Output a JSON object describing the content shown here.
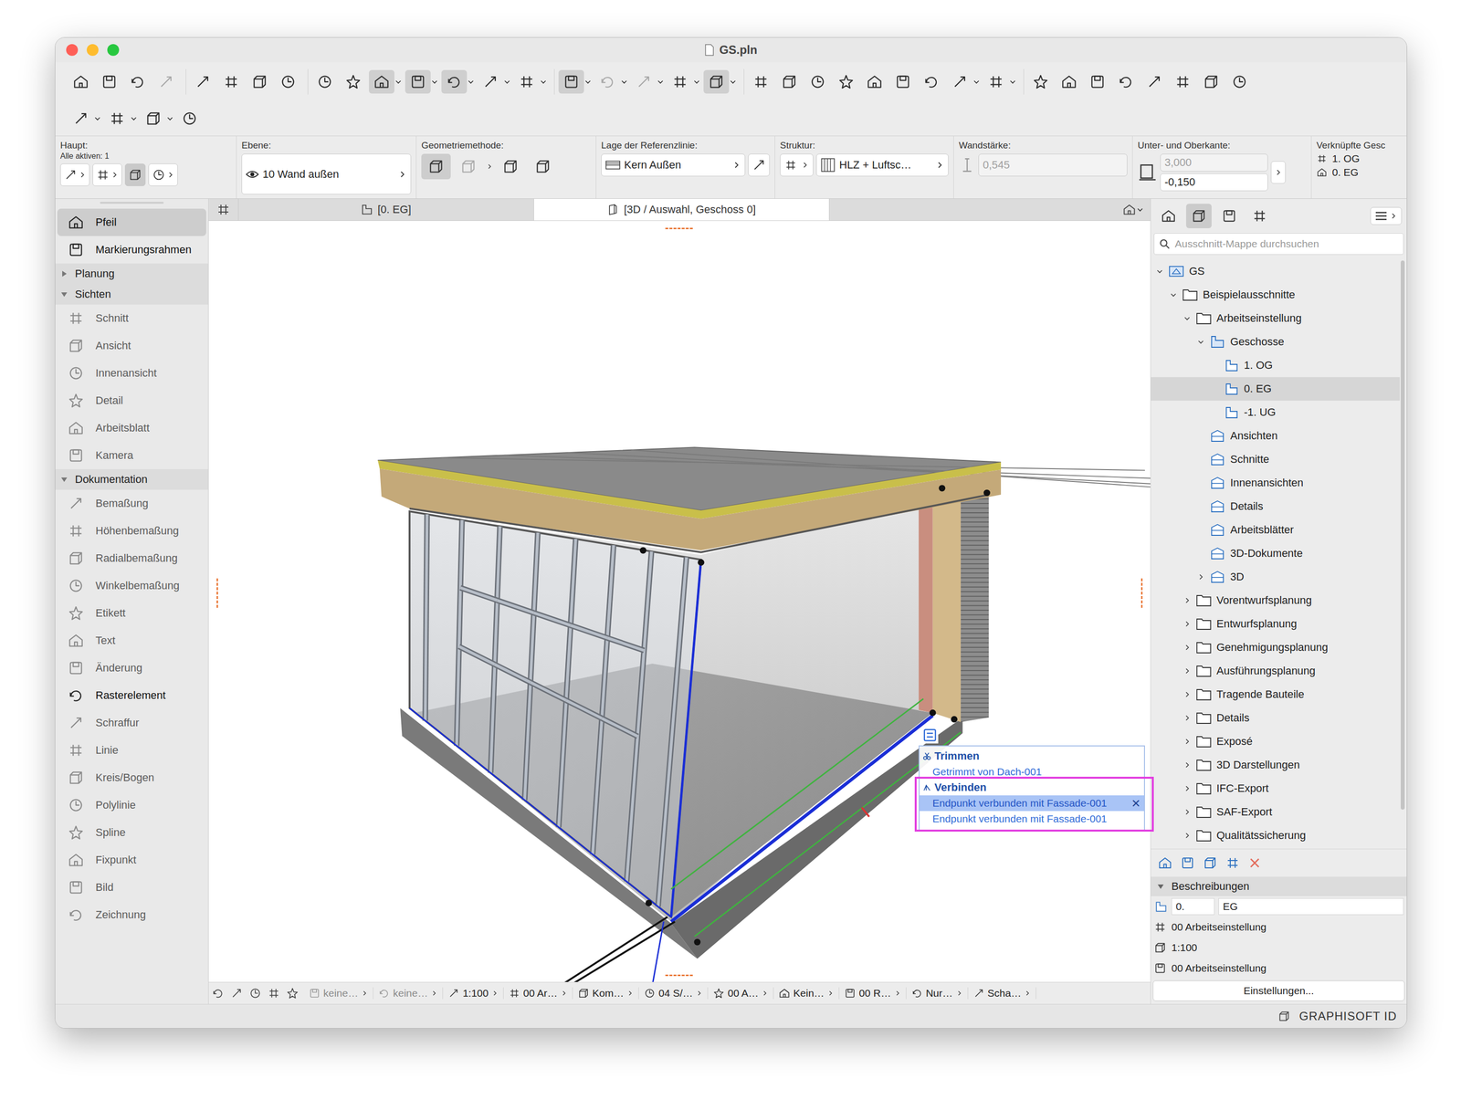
{
  "window": {
    "title": "GS.pln"
  },
  "toolbar_main": [
    [
      {
        "menu": false,
        "pressed": false,
        "disabled": false
      },
      {
        "menu": false,
        "pressed": false,
        "disabled": false
      },
      {
        "menu": false,
        "pressed": false,
        "disabled": false
      },
      {
        "menu": false,
        "pressed": false,
        "disabled": true
      }
    ],
    [
      {
        "menu": false,
        "pressed": false,
        "disabled": false
      },
      {
        "menu": false,
        "pressed": false,
        "disabled": false
      },
      {
        "menu": false,
        "pressed": false,
        "disabled": false
      },
      {
        "menu": false,
        "pressed": false,
        "disabled": false
      }
    ],
    [
      {
        "menu": false,
        "pressed": false,
        "disabled": false
      },
      {
        "menu": false,
        "pressed": false,
        "disabled": false
      },
      {
        "menu": true,
        "pressed": true,
        "disabled": false
      },
      {
        "menu": true,
        "pressed": true,
        "disabled": false
      },
      {
        "menu": true,
        "pressed": true,
        "disabled": false
      },
      {
        "menu": true,
        "pressed": false,
        "disabled": false
      },
      {
        "menu": true,
        "pressed": false,
        "disabled": false
      }
    ],
    [
      {
        "menu": true,
        "pressed": true,
        "disabled": false
      },
      {
        "menu": true,
        "pressed": false,
        "disabled": true
      },
      {
        "menu": true,
        "pressed": false,
        "disabled": true
      },
      {
        "menu": true,
        "pressed": false,
        "disabled": false
      },
      {
        "menu": true,
        "pressed": true,
        "disabled": false
      }
    ],
    [
      {
        "menu": false,
        "pressed": false,
        "disabled": false
      },
      {
        "menu": false,
        "pressed": false,
        "disabled": false
      },
      {
        "menu": false,
        "pressed": false,
        "disabled": false
      },
      {
        "menu": false,
        "pressed": false,
        "disabled": false
      },
      {
        "menu": false,
        "pressed": false,
        "disabled": false
      },
      {
        "menu": false,
        "pressed": false,
        "disabled": false
      },
      {
        "menu": false,
        "pressed": false,
        "disabled": false
      },
      {
        "menu": true,
        "pressed": false,
        "disabled": false
      },
      {
        "menu": true,
        "pressed": false,
        "disabled": false
      }
    ],
    [
      {
        "menu": false,
        "pressed": false,
        "disabled": false
      },
      {
        "menu": false,
        "pressed": false,
        "disabled": false
      },
      {
        "menu": false,
        "pressed": false,
        "disabled": false
      },
      {
        "menu": false,
        "pressed": false,
        "disabled": false
      },
      {
        "menu": false,
        "pressed": false,
        "disabled": false
      },
      {
        "menu": false,
        "pressed": false,
        "disabled": false
      },
      {
        "menu": false,
        "pressed": false,
        "disabled": false
      },
      {
        "menu": false,
        "pressed": false,
        "disabled": false
      }
    ]
  ],
  "toolbar_secondary": [
    {
      "menu": true,
      "pressed": false,
      "disabled": false
    },
    {
      "menu": true,
      "pressed": false,
      "disabled": false
    },
    {
      "menu": true,
      "pressed": false,
      "disabled": false
    },
    {
      "menu": false,
      "pressed": false,
      "disabled": false
    }
  ],
  "info_box": {
    "main": {
      "label": "Haupt:",
      "active": "Alle aktiven: 1",
      "controls": [
        {
          "pressed": false
        },
        {
          "pressed": false
        },
        {
          "pressed": true
        },
        {
          "pressed": false
        }
      ]
    },
    "layer": {
      "label": "Ebene:",
      "value": "10 Wand außen"
    },
    "geometry": {
      "label": "Geometriemethode:",
      "options": [
        {
          "selected": true,
          "disabled": false
        },
        {
          "selected": false,
          "disabled": true
        },
        {
          "selected": false,
          "disabled": false
        },
        {
          "selected": false,
          "disabled": false
        }
      ]
    },
    "reference_line": {
      "label": "Lage der Referenzlinie:",
      "value": "Kern Außen"
    },
    "structure": {
      "label": "Struktur:",
      "value": "HLZ + Luftsc…"
    },
    "thickness": {
      "label": "Wandstärke:",
      "value": "0,545",
      "disabled": true
    },
    "top_bottom": {
      "label": "Unter- und Oberkante:",
      "top": "3,000",
      "top_disabled": true,
      "bottom": "-0,150"
    },
    "linked_stories": {
      "label": "Verknüpfte Gesc",
      "top": "1. OG",
      "bottom": "0. EG"
    }
  },
  "toolbox": [
    {
      "kind": "tool",
      "label": "Pfeil",
      "selected": true,
      "disabled": false
    },
    {
      "kind": "tool",
      "label": "Markierungsrahmen",
      "selected": false,
      "disabled": false
    },
    {
      "kind": "section",
      "label": "Planung",
      "expanded": false
    },
    {
      "kind": "section",
      "label": "Sichten",
      "expanded": true
    },
    {
      "kind": "tool",
      "label": "Schnitt",
      "selected": false,
      "disabled": true
    },
    {
      "kind": "tool",
      "label": "Ansicht",
      "selected": false,
      "disabled": true
    },
    {
      "kind": "tool",
      "label": "Innenansicht",
      "selected": false,
      "disabled": true
    },
    {
      "kind": "tool",
      "label": "Detail",
      "selected": false,
      "disabled": true
    },
    {
      "kind": "tool",
      "label": "Arbeitsblatt",
      "selected": false,
      "disabled": true
    },
    {
      "kind": "tool",
      "label": "Kamera",
      "selected": false,
      "disabled": true
    },
    {
      "kind": "section",
      "label": "Dokumentation",
      "expanded": true
    },
    {
      "kind": "tool",
      "label": "Bemaßung",
      "selected": false,
      "disabled": true
    },
    {
      "kind": "tool",
      "label": "Höhenbemaßung",
      "selected": false,
      "disabled": true
    },
    {
      "kind": "tool",
      "label": "Radialbemaßung",
      "selected": false,
      "disabled": true
    },
    {
      "kind": "tool",
      "label": "Winkelbemaßung",
      "selected": false,
      "disabled": true
    },
    {
      "kind": "tool",
      "label": "Etikett",
      "selected": false,
      "disabled": true
    },
    {
      "kind": "tool",
      "label": "Text",
      "selected": false,
      "disabled": true
    },
    {
      "kind": "tool",
      "label": "Änderung",
      "selected": false,
      "disabled": true
    },
    {
      "kind": "tool",
      "label": "Rasterelement",
      "selected": false,
      "disabled": false
    },
    {
      "kind": "tool",
      "label": "Schraffur",
      "selected": false,
      "disabled": true
    },
    {
      "kind": "tool",
      "label": "Linie",
      "selected": false,
      "disabled": true
    },
    {
      "kind": "tool",
      "label": "Kreis/Bogen",
      "selected": false,
      "disabled": true
    },
    {
      "kind": "tool",
      "label": "Polylinie",
      "selected": false,
      "disabled": true
    },
    {
      "kind": "tool",
      "label": "Spline",
      "selected": false,
      "disabled": true
    },
    {
      "kind": "tool",
      "label": "Fixpunkt",
      "selected": false,
      "disabled": true
    },
    {
      "kind": "tool",
      "label": "Bild",
      "selected": false,
      "disabled": true
    },
    {
      "kind": "tool",
      "label": "Zeichnung",
      "selected": false,
      "disabled": true
    }
  ],
  "tabs": [
    {
      "label": "[0. EG]",
      "selected": false,
      "kind": "plan"
    },
    {
      "label": "[3D / Auswahl, Geschoss 0]",
      "selected": true,
      "kind": "3d"
    }
  ],
  "popup": {
    "close": "×",
    "sections": [
      {
        "title": "Trimmen",
        "highlighted": false,
        "items": [
          {
            "label": "Getrimmt von Dach-001",
            "selected": false
          }
        ]
      },
      {
        "title": "Verbinden",
        "highlighted": true,
        "items": [
          {
            "label": "Endpunkt verbunden mit Fassade-001",
            "selected": true
          },
          {
            "label": "Endpunkt verbunden mit Fassade-001",
            "selected": false
          }
        ]
      }
    ]
  },
  "status_bar": [
    {
      "label": "keine…",
      "disabled": true
    },
    {
      "label": "keine…",
      "disabled": true
    },
    {
      "label": "1:100",
      "disabled": false
    },
    {
      "label": "00 Ar…",
      "disabled": false
    },
    {
      "label": "Kom…",
      "disabled": false
    },
    {
      "label": "04 S/…",
      "disabled": false
    },
    {
      "label": "00 A…",
      "disabled": false
    },
    {
      "label": "Kein…",
      "disabled": false
    },
    {
      "label": "00 R…",
      "disabled": false
    },
    {
      "label": "Nur…",
      "disabled": false
    },
    {
      "label": "Scha…",
      "disabled": false
    }
  ],
  "navigator": {
    "modes": [
      {
        "selected": false
      },
      {
        "selected": true
      },
      {
        "selected": false
      },
      {
        "selected": false
      }
    ],
    "search": {
      "placeholder": "Ausschnitt-Mappe durchsuchen"
    },
    "tree": [
      {
        "label": "GS",
        "level": 0,
        "expandable": true,
        "expanded": true,
        "selected": false,
        "kind": "project"
      },
      {
        "label": "Beispielausschnitte",
        "level": 1,
        "expandable": true,
        "expanded": true,
        "selected": false,
        "kind": "folder"
      },
      {
        "label": "Arbeitseinstellung",
        "level": 2,
        "expandable": true,
        "expanded": true,
        "selected": false,
        "kind": "folder"
      },
      {
        "label": "Geschosse",
        "level": 3,
        "expandable": true,
        "expanded": true,
        "selected": false,
        "kind": "stories"
      },
      {
        "label": "1. OG",
        "level": 4,
        "expandable": false,
        "expanded": false,
        "selected": false,
        "kind": "story"
      },
      {
        "label": "0. EG",
        "level": 4,
        "expandable": false,
        "expanded": false,
        "selected": true,
        "kind": "story"
      },
      {
        "label": "-1. UG",
        "level": 4,
        "expandable": false,
        "expanded": false,
        "selected": false,
        "kind": "story"
      },
      {
        "label": "Ansichten",
        "level": 3,
        "expandable": false,
        "expanded": false,
        "selected": false,
        "kind": "view"
      },
      {
        "label": "Schnitte",
        "level": 3,
        "expandable": false,
        "expanded": false,
        "selected": false,
        "kind": "view"
      },
      {
        "label": "Innenansichten",
        "level": 3,
        "expandable": false,
        "expanded": false,
        "selected": false,
        "kind": "view"
      },
      {
        "label": "Details",
        "level": 3,
        "expandable": false,
        "expanded": false,
        "selected": false,
        "kind": "view"
      },
      {
        "label": "Arbeitsblätter",
        "level": 3,
        "expandable": false,
        "expanded": false,
        "selected": false,
        "kind": "view"
      },
      {
        "label": "3D-Dokumente",
        "level": 3,
        "expandable": false,
        "expanded": false,
        "selected": false,
        "kind": "view"
      },
      {
        "label": "3D",
        "level": 3,
        "expandable": true,
        "expanded": false,
        "selected": false,
        "kind": "view"
      },
      {
        "label": "Vorentwurfsplanung",
        "level": 2,
        "expandable": true,
        "expanded": false,
        "selected": false,
        "kind": "folder"
      },
      {
        "label": "Entwurfsplanung",
        "level": 2,
        "expandable": true,
        "expanded": false,
        "selected": false,
        "kind": "folder"
      },
      {
        "label": "Genehmigungsplanung",
        "level": 2,
        "expandable": true,
        "expanded": false,
        "selected": false,
        "kind": "folder"
      },
      {
        "label": "Ausführungsplanung",
        "level": 2,
        "expandable": true,
        "expanded": false,
        "selected": false,
        "kind": "folder"
      },
      {
        "label": "Tragende Bauteile",
        "level": 2,
        "expandable": true,
        "expanded": false,
        "selected": false,
        "kind": "folder"
      },
      {
        "label": "Details",
        "level": 2,
        "expandable": true,
        "expanded": false,
        "selected": false,
        "kind": "folder"
      },
      {
        "label": "Exposé",
        "level": 2,
        "expandable": true,
        "expanded": false,
        "selected": false,
        "kind": "folder"
      },
      {
        "label": "3D Darstellungen",
        "level": 2,
        "expandable": true,
        "expanded": false,
        "selected": false,
        "kind": "folder"
      },
      {
        "label": "IFC-Export",
        "level": 2,
        "expandable": true,
        "expanded": false,
        "selected": false,
        "kind": "folder"
      },
      {
        "label": "SAF-Export",
        "level": 2,
        "expandable": true,
        "expanded": false,
        "selected": false,
        "kind": "folder"
      },
      {
        "label": "Qualitätssicherung",
        "level": 2,
        "expandable": true,
        "expanded": false,
        "selected": false,
        "kind": "folder"
      }
    ],
    "descriptions": {
      "title": "Beschreibungen",
      "expanded": true,
      "id": "0.",
      "name": "EG",
      "rows": [
        {
          "label": "00 Arbeitseinstellung",
          "kind": "layers"
        },
        {
          "label": "1:100",
          "kind": "scale"
        },
        {
          "label": "00 Arbeitseinstellung",
          "kind": "model"
        }
      ],
      "button": "Einstellungen..."
    }
  },
  "footer": {
    "account": "GRAPHISOFT ID"
  }
}
